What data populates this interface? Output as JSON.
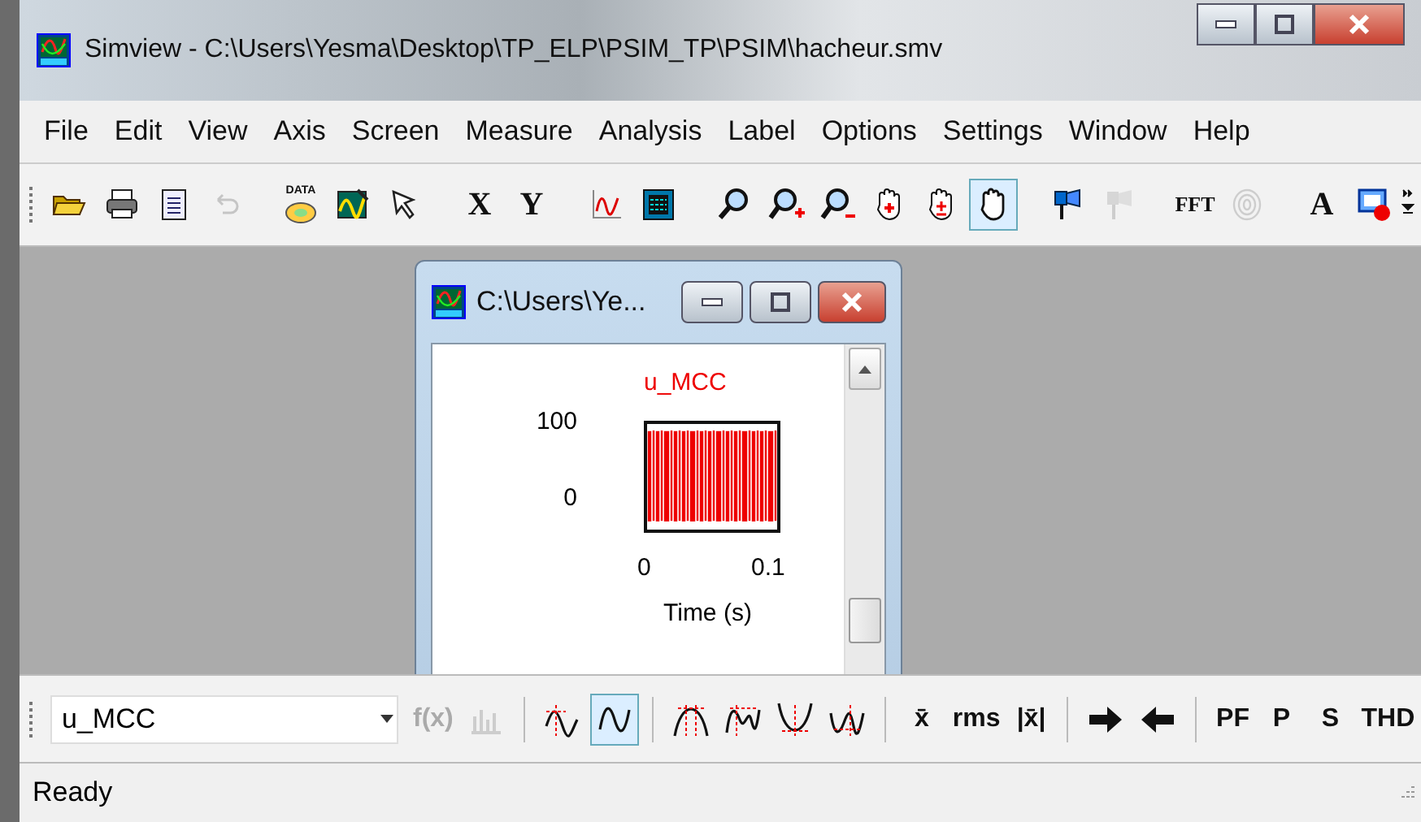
{
  "window": {
    "title": "Simview - C:\\Users\\Yesma\\Desktop\\TP_ELP\\PSIM_TP\\PSIM\\hacheur.smv"
  },
  "menu": [
    "File",
    "Edit",
    "View",
    "Axis",
    "Screen",
    "Measure",
    "Analysis",
    "Label",
    "Options",
    "Settings",
    "Window",
    "Help"
  ],
  "toolbar": [
    [
      {
        "kind": "icon",
        "selected": false,
        "disabled": false
      },
      {
        "kind": "icon",
        "selected": false,
        "disabled": false
      },
      {
        "kind": "icon",
        "selected": false,
        "disabled": false
      },
      {
        "kind": "icon",
        "selected": false,
        "disabled": true
      }
    ],
    [
      {
        "kind": "data",
        "text": "DATA",
        "selected": false,
        "disabled": false
      },
      {
        "kind": "icon",
        "selected": false,
        "disabled": false
      },
      {
        "kind": "icon",
        "selected": false,
        "disabled": false
      }
    ],
    [
      {
        "kind": "text",
        "text": "X",
        "selected": false,
        "disabled": false
      },
      {
        "kind": "text",
        "text": "Y",
        "selected": false,
        "disabled": false
      }
    ],
    [
      {
        "kind": "icon",
        "selected": false,
        "disabled": false
      },
      {
        "kind": "icon",
        "selected": false,
        "disabled": false
      }
    ],
    [
      {
        "kind": "icon",
        "selected": false,
        "disabled": false
      },
      {
        "kind": "icon",
        "selected": false,
        "disabled": false
      },
      {
        "kind": "icon",
        "selected": false,
        "disabled": false
      },
      {
        "kind": "icon",
        "selected": false,
        "disabled": false
      },
      {
        "kind": "icon",
        "selected": false,
        "disabled": false
      },
      {
        "kind": "icon",
        "selected": true,
        "disabled": false
      }
    ],
    [
      {
        "kind": "icon",
        "selected": false,
        "disabled": false
      },
      {
        "kind": "icon",
        "selected": false,
        "disabled": true
      }
    ],
    [
      {
        "kind": "text",
        "text": "FFT",
        "selected": false,
        "disabled": false
      },
      {
        "kind": "icon",
        "selected": false,
        "disabled": true
      }
    ],
    [
      {
        "kind": "text",
        "text": "A",
        "selected": false,
        "disabled": false
      },
      {
        "kind": "icon",
        "selected": false,
        "disabled": false
      }
    ]
  ],
  "child_window": {
    "title": "C:\\Users\\Ye...",
    "plot": {
      "title": "u_MCC",
      "y_ticks": [
        "100",
        "0"
      ],
      "x_ticks": [
        "0",
        "0.1"
      ],
      "xlabel": "Time (s)"
    }
  },
  "curve_toolbar": {
    "curve": "u_MCC",
    "groups": [
      [
        {
          "kind": "text",
          "text": "f(x)",
          "selected": false,
          "disabled": true
        },
        {
          "kind": "icon",
          "selected": false,
          "disabled": true
        }
      ],
      [
        {
          "kind": "icon",
          "selected": false,
          "disabled": false
        },
        {
          "kind": "icon",
          "selected": true,
          "disabled": false
        }
      ],
      [
        {
          "kind": "icon",
          "selected": false,
          "disabled": false
        },
        {
          "kind": "icon",
          "selected": false,
          "disabled": false
        },
        {
          "kind": "icon",
          "selected": false,
          "disabled": false
        },
        {
          "kind": "icon",
          "selected": false,
          "disabled": false
        }
      ],
      [
        {
          "kind": "text",
          "text": "x̄",
          "selected": false,
          "disabled": false
        },
        {
          "kind": "text",
          "text": "rms",
          "selected": false,
          "disabled": false
        },
        {
          "kind": "text",
          "text": "|x̄|",
          "selected": false,
          "disabled": false
        }
      ],
      [
        {
          "kind": "icon",
          "selected": false,
          "disabled": false
        },
        {
          "kind": "icon",
          "selected": false,
          "disabled": false
        }
      ],
      [
        {
          "kind": "text",
          "text": "PF",
          "selected": false,
          "disabled": false
        },
        {
          "kind": "text",
          "text": "P",
          "selected": false,
          "disabled": false
        },
        {
          "kind": "text",
          "text": "S",
          "selected": false,
          "disabled": false
        },
        {
          "kind": "text",
          "text": "THD",
          "selected": false,
          "disabled": false
        }
      ]
    ]
  },
  "status_bar": "Ready"
}
